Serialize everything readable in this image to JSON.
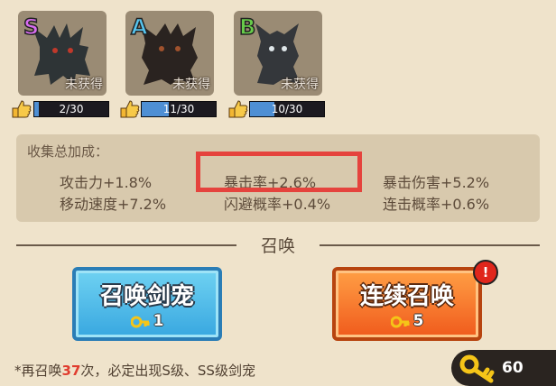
{
  "pets": [
    {
      "grade": "S",
      "status": "未获得",
      "progress_text": "2/30",
      "progress": 0.067
    },
    {
      "grade": "A",
      "status": "未获得",
      "progress_text": "11/30",
      "progress": 0.367
    },
    {
      "grade": "B",
      "status": "未获得",
      "progress_text": "10/30",
      "progress": 0.333
    }
  ],
  "stats": {
    "title": "收集总加成：",
    "attack": "攻击力+1.8%",
    "crit_rate": "暴击率+2.6%",
    "crit_damage": "暴击伤害+5.2%",
    "move_speed": "移动速度+7.2%",
    "dodge": "闪避概率+0.4%",
    "combo": "连击概率+0.6%"
  },
  "summon": {
    "title": "召唤",
    "single_label": "召唤剑宠",
    "single_cost": "1",
    "multi_label": "连续召唤",
    "multi_cost": "5",
    "alert": "!"
  },
  "footnote": {
    "prefix": "*再召唤",
    "count": "37",
    "suffix": "次，必定出现S级、SS级剑宠"
  },
  "keys": {
    "count": "60"
  },
  "colors": {
    "blue_button": "#38a7e0",
    "orange_button": "#f05a1c",
    "highlight_box": "#e5433d",
    "progress_fill": "#4e8fd4"
  },
  "icons": [
    "hand-point-icon",
    "key-icon",
    "alert-icon"
  ]
}
